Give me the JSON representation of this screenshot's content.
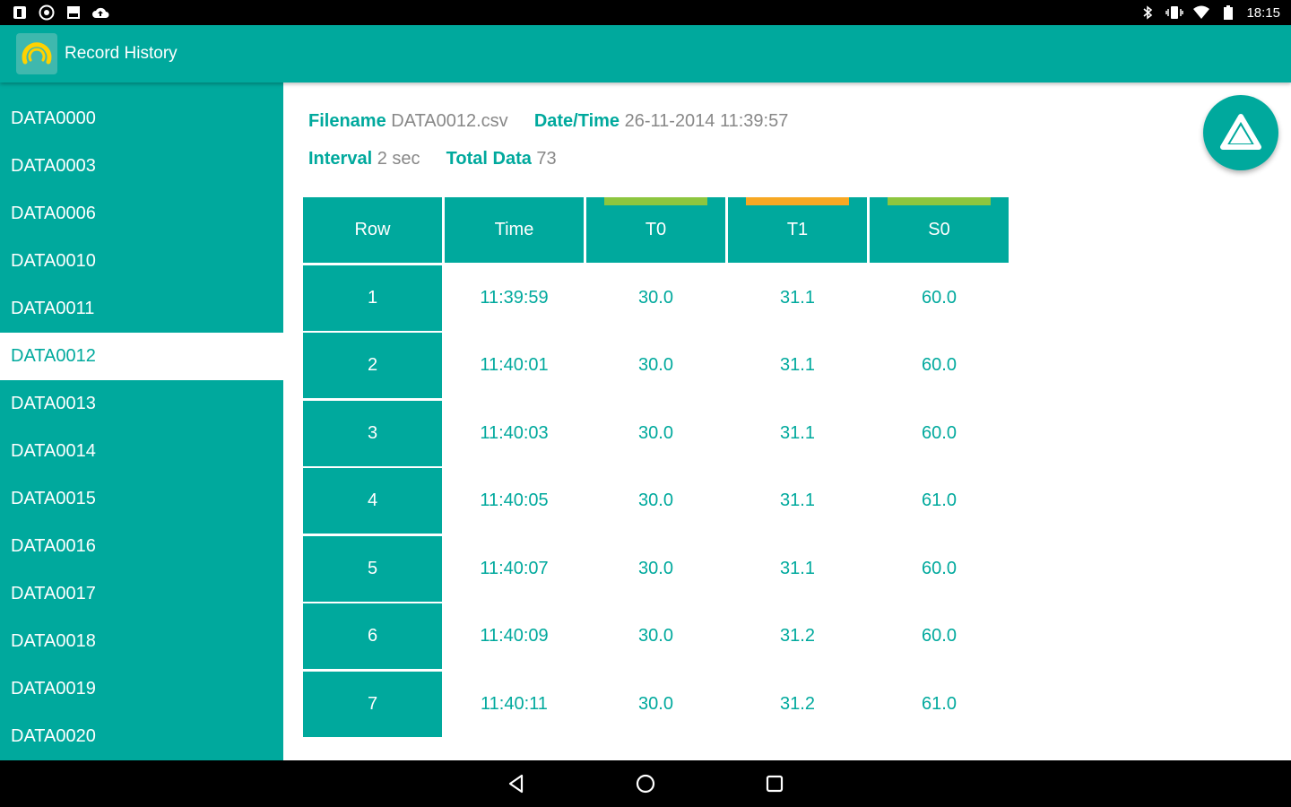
{
  "status_bar": {
    "time": "18:15",
    "left_icons": [
      "app-notification-icon",
      "settings-notification-icon",
      "image-notification-icon",
      "cloud-upload-icon"
    ],
    "right_icons": [
      "bluetooth-icon",
      "vibrate-icon",
      "wifi-icon",
      "battery-icon"
    ]
  },
  "app_bar": {
    "title": "Record History",
    "logo_icon": "gauge-logo-icon"
  },
  "sidebar": {
    "items": [
      {
        "label": "DATA0000",
        "selected": false
      },
      {
        "label": "DATA0003",
        "selected": false
      },
      {
        "label": "DATA0006",
        "selected": false
      },
      {
        "label": "DATA0010",
        "selected": false
      },
      {
        "label": "DATA0011",
        "selected": false
      },
      {
        "label": "DATA0012",
        "selected": true
      },
      {
        "label": "DATA0013",
        "selected": false
      },
      {
        "label": "DATA0014",
        "selected": false
      },
      {
        "label": "DATA0015",
        "selected": false
      },
      {
        "label": "DATA0016",
        "selected": false
      },
      {
        "label": "DATA0017",
        "selected": false
      },
      {
        "label": "DATA0018",
        "selected": false
      },
      {
        "label": "DATA0019",
        "selected": false
      },
      {
        "label": "DATA0020",
        "selected": false
      }
    ]
  },
  "info": {
    "filename_label": "Filename",
    "filename": "DATA0012.csv",
    "datetime_label": "Date/Time",
    "datetime": "26-11-2014 11:39:57",
    "interval_label": "Interval",
    "interval": "2 sec",
    "total_label": "Total Data",
    "total": "73"
  },
  "table": {
    "headers": [
      {
        "label": "Row",
        "bar_color": null
      },
      {
        "label": "Time",
        "bar_color": null
      },
      {
        "label": "T0",
        "bar_color": "#8dc63f"
      },
      {
        "label": "T1",
        "bar_color": "#f7a823"
      },
      {
        "label": "S0",
        "bar_color": "#8dc63f"
      }
    ],
    "rows": [
      [
        "1",
        "11:39:59",
        "30.0",
        "31.1",
        "60.0"
      ],
      [
        "2",
        "11:40:01",
        "30.0",
        "31.1",
        "60.0"
      ],
      [
        "3",
        "11:40:03",
        "30.0",
        "31.1",
        "60.0"
      ],
      [
        "4",
        "11:40:05",
        "30.0",
        "31.1",
        "61.0"
      ],
      [
        "5",
        "11:40:07",
        "30.0",
        "31.1",
        "60.0"
      ],
      [
        "6",
        "11:40:09",
        "30.0",
        "31.2",
        "60.0"
      ],
      [
        "7",
        "11:40:11",
        "30.0",
        "31.2",
        "61.0"
      ]
    ]
  },
  "fab": {
    "icon": "upload-triangle-icon"
  },
  "nav_bar": {
    "icons": [
      "back-icon",
      "home-icon",
      "recents-icon"
    ]
  },
  "colors": {
    "primary": "#00a99d",
    "status_bar": "#000000",
    "text_muted": "#888888",
    "accent_green": "#8dc63f",
    "accent_orange": "#f7a823"
  }
}
